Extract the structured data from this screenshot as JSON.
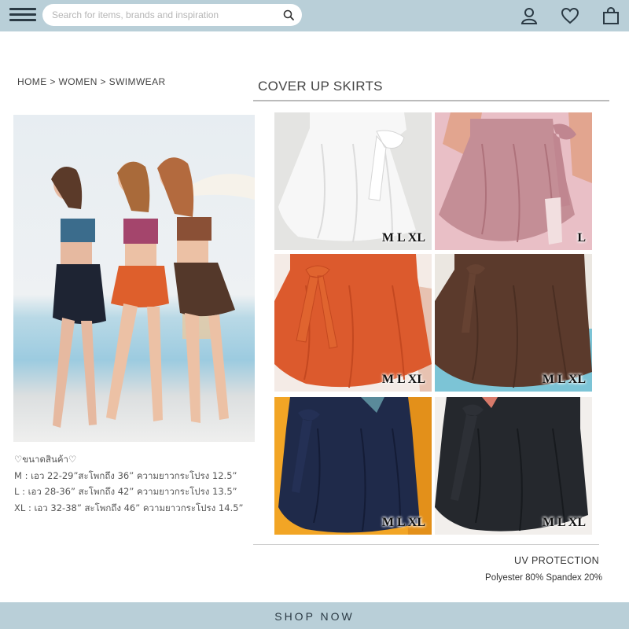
{
  "header": {
    "search_placeholder": "Search for items, brands and inspiration",
    "icons": [
      "menu-icon",
      "search-icon",
      "user-icon",
      "heart-icon",
      "bag-icon"
    ],
    "bar_color": "#b9cfd8"
  },
  "breadcrumb": "HOME > WOMEN  >  SWIMWEAR",
  "page_title": "COVER UP SKIRTS",
  "size_info": {
    "heading": "♡ขนาดสินค้า♡",
    "lines": [
      "M : เอว 22-29”สะโพกถึง 36” ความยาวกระโปรง 12.5”",
      "L : เอว 28-36” สะโพกถึง 42” ความยาวกระโปรง 13.5”",
      "XL : เอว 32-38” สะโพกถึง 46” ความยาวกระโปรง 14.5”"
    ]
  },
  "products": [
    {
      "color": "white",
      "hex": "#f1f1f1",
      "sizes": "M L XL"
    },
    {
      "color": "pink",
      "hex": "#c58f97",
      "sizes": "L"
    },
    {
      "color": "orange",
      "hex": "#d8582c",
      "sizes": "M L XL"
    },
    {
      "color": "brown",
      "hex": "#5b3a2c",
      "sizes": "M L XL"
    },
    {
      "color": "navy",
      "hex": "#1d2744",
      "sizes": "M L XL"
    },
    {
      "color": "black",
      "hex": "#24272c",
      "sizes": "M L XL"
    }
  ],
  "features": {
    "uv": "UV PROTECTION",
    "material": "Polyester 80% Spandex 20%"
  },
  "cta": "SHOP NOW"
}
